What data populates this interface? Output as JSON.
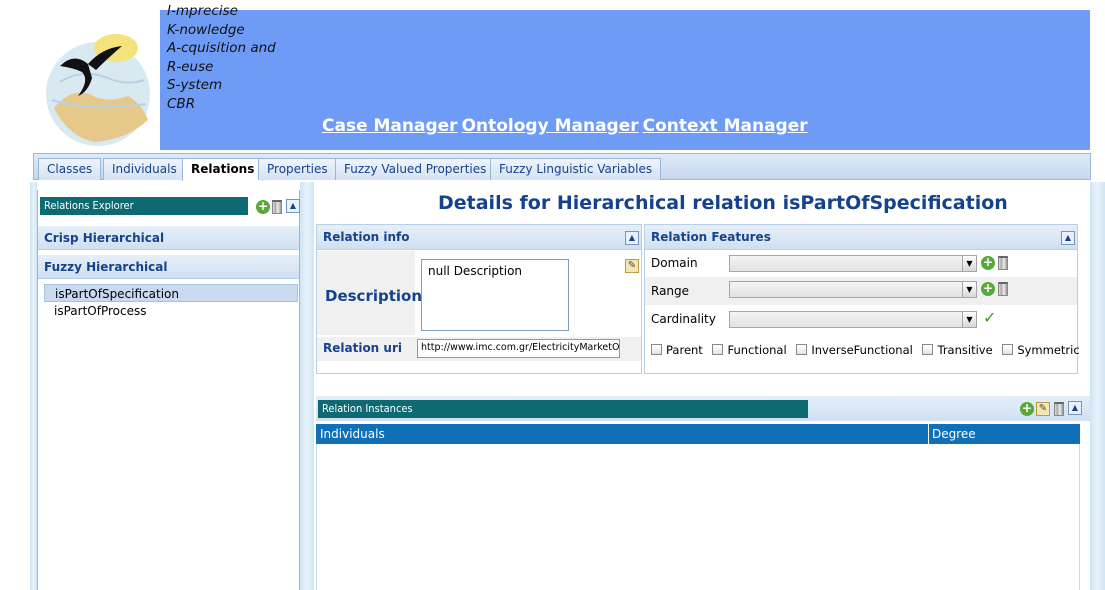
{
  "header": {
    "acronym": [
      "I-mprecise",
      "K-nowledge",
      "A-cquisition and",
      "R-euse",
      "S-ystem",
      "CBR"
    ],
    "nav": [
      "Case Manager",
      "Ontology Manager",
      "Context Manager"
    ],
    "banner_color": "#6e9bf6"
  },
  "tabs": [
    {
      "label": "Classes"
    },
    {
      "label": "Individuals"
    },
    {
      "label": "Relations",
      "active": true
    },
    {
      "label": "Properties"
    },
    {
      "label": "Fuzzy Valued Properties"
    },
    {
      "label": "Fuzzy Linguistic Variables"
    }
  ],
  "explorer": {
    "title": "Relations Explorer",
    "sections": [
      {
        "label": "Crisp Hierarchical"
      },
      {
        "label": "Fuzzy Hierarchical"
      }
    ],
    "items": [
      {
        "label": "isPartOfSpecification",
        "selected": true
      },
      {
        "label": "isPartOfProcess",
        "selected": false
      }
    ]
  },
  "details": {
    "title": "Details for Hierarchical relation isPartOfSpecification",
    "relation_info": {
      "header": "Relation info",
      "description_label": "Description",
      "description_value": "null Description",
      "uri_label": "Relation uri",
      "uri_value": "http://www.imc.com.gr/ElectricityMarketOntology"
    },
    "relation_features": {
      "header": "Relation Features",
      "domain_label": "Domain",
      "range_label": "Range",
      "cardinality_label": "Cardinality",
      "checkboxes": [
        "Parent",
        "Functional",
        "InverseFunctional",
        "Transitive",
        "Symmetric"
      ]
    },
    "instances": {
      "title": "Relation Instances",
      "columns": [
        "Individuals",
        "Degree"
      ]
    }
  },
  "colors": {
    "accent_dark": "#0d6a73",
    "grid_header": "#0f70b8",
    "title_blue": "#15428b"
  }
}
